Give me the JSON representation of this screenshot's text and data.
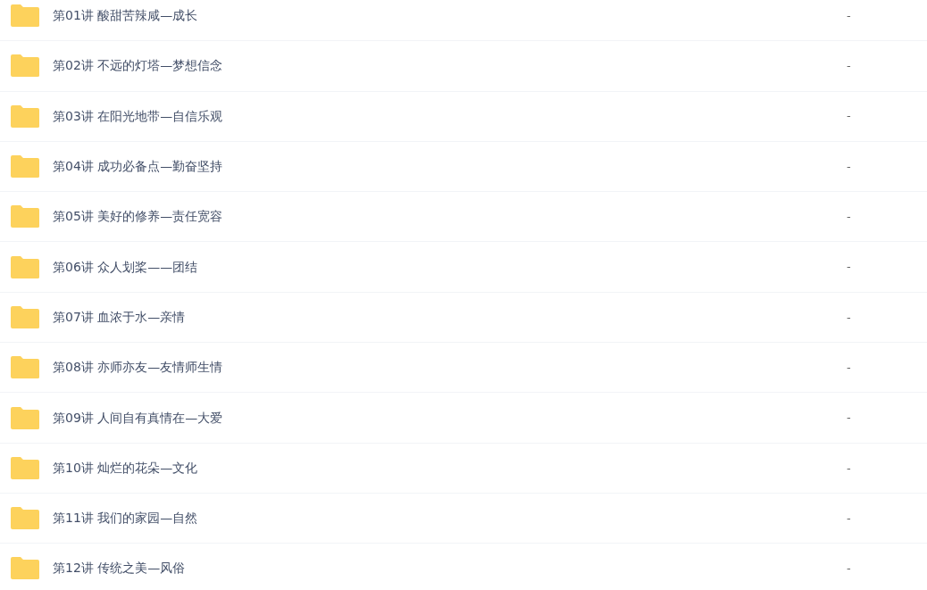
{
  "files": [
    {
      "name": "第01讲 酸甜苦辣咸—成长",
      "size": "-"
    },
    {
      "name": "第02讲 不远的灯塔—梦想信念",
      "size": "-"
    },
    {
      "name": "第03讲 在阳光地带—自信乐观",
      "size": "-"
    },
    {
      "name": "第04讲 成功必备点—勤奋坚持",
      "size": "-"
    },
    {
      "name": "第05讲 美好的修养—责任宽容",
      "size": "-"
    },
    {
      "name": "第06讲 众人划桨——团结",
      "size": "-"
    },
    {
      "name": "第07讲 血浓于水—亲情",
      "size": "-"
    },
    {
      "name": "第08讲 亦师亦友—友情师生情",
      "size": "-"
    },
    {
      "name": "第09讲 人间自有真情在—大爱",
      "size": "-"
    },
    {
      "name": "第10讲 灿烂的花朵—文化",
      "size": "-"
    },
    {
      "name": "第11讲 我们的家园—自然",
      "size": "-"
    },
    {
      "name": "第12讲 传统之美—风俗",
      "size": "-"
    }
  ]
}
